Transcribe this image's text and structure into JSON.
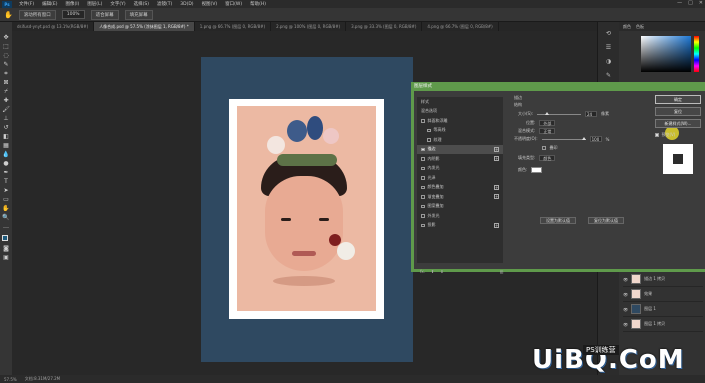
{
  "app": {
    "logo": "Ps"
  },
  "menubar": {
    "items": [
      "文件(F)",
      "编辑(E)",
      "图像(I)",
      "图层(L)",
      "文字(Y)",
      "选择(S)",
      "滤镜(T)",
      "3D(D)",
      "视图(V)",
      "窗口(W)",
      "帮助(H)"
    ]
  },
  "window_controls": {
    "minimize": "—",
    "maximize": "□",
    "close": "✕"
  },
  "options": {
    "tool_icon": "hand-icon",
    "btn1": "滚动所有窗口",
    "zoom": "100%",
    "btn2": "适合屏幕",
    "btn3": "填充屏幕"
  },
  "tabs": [
    {
      "label": "dsifusd-ynyt.psd @ 13.1%(RGB/8#)",
      "active": false
    },
    {
      "label": "人像合成.psd @ 57.5% (涂抹图层 1, RGB/8#) *",
      "active": true
    },
    {
      "label": "1.png @ 66.7% (图层 0, RGB/8#)",
      "active": false
    },
    {
      "label": "2.png @ 100% (图层 0, RGB/8#)",
      "active": false
    },
    {
      "label": "3.png @ 33.3% (图层 0, RGB/8#)",
      "active": false
    },
    {
      "label": "4.png @ 66.7% (图层 0, RGB/8#)",
      "active": false
    }
  ],
  "color_panel": {
    "tab1": "颜色",
    "tab2": "色板"
  },
  "dialog": {
    "title": "图层样式",
    "styles": [
      {
        "label": "样式",
        "checkbox": false,
        "plus": false,
        "selected": false
      },
      {
        "label": "混合选项",
        "checkbox": false,
        "plus": false,
        "selected": false
      },
      {
        "label": "斜面和浮雕",
        "checkbox": true,
        "plus": false,
        "selected": false
      },
      {
        "label": "等高线",
        "checkbox": true,
        "plus": false,
        "selected": false
      },
      {
        "label": "纹理",
        "checkbox": true,
        "plus": false,
        "selected": false
      },
      {
        "label": "描边",
        "checkbox": true,
        "plus": true,
        "selected": true
      },
      {
        "label": "内阴影",
        "checkbox": true,
        "plus": true,
        "selected": false
      },
      {
        "label": "内发光",
        "checkbox": true,
        "plus": false,
        "selected": false
      },
      {
        "label": "光泽",
        "checkbox": true,
        "plus": false,
        "selected": false
      },
      {
        "label": "颜色叠加",
        "checkbox": true,
        "plus": true,
        "selected": false
      },
      {
        "label": "渐变叠加",
        "checkbox": true,
        "plus": true,
        "selected": false
      },
      {
        "label": "图案叠加",
        "checkbox": true,
        "plus": false,
        "selected": false
      },
      {
        "label": "外发光",
        "checkbox": true,
        "plus": false,
        "selected": false
      },
      {
        "label": "投影",
        "checkbox": true,
        "plus": true,
        "selected": false
      }
    ],
    "fx": {
      "label": "fx.",
      "up": "⬆",
      "down": "⬇",
      "trash": "🗑"
    },
    "stroke": {
      "section": "描边",
      "group": "结构",
      "size_label": "大小(S):",
      "size_value": "24",
      "size_unit": "像素",
      "position_label": "位置:",
      "position_value": "外部",
      "blend_label": "混合模式:",
      "blend_value": "正常",
      "opacity_label": "不透明度(O):",
      "opacity_value": "100",
      "opacity_unit": "%",
      "overprint_label": "叠印",
      "fill_type_label": "填充类型:",
      "fill_type_value": "颜色",
      "color_label": "颜色:",
      "btn_default": "设置为默认值",
      "btn_reset": "复位为默认值"
    },
    "buttons": {
      "ok": "确定",
      "cancel": "复位",
      "new_style": "新建样式(W)...",
      "preview": "预览(V)"
    }
  },
  "layers": [
    {
      "name": "描边 1 拷贝",
      "thumb": "light"
    },
    {
      "name": "效果",
      "thumb": "light"
    },
    {
      "name": "图层 1",
      "thumb": "dark"
    },
    {
      "name": "图层 1 拷贝",
      "thumb": "light"
    }
  ],
  "status": {
    "zoom": "57.5%",
    "doc": "文档:8.31M/27.2M"
  },
  "watermark": {
    "main": "UiBQ.CoM",
    "sub": "PS训练营"
  }
}
